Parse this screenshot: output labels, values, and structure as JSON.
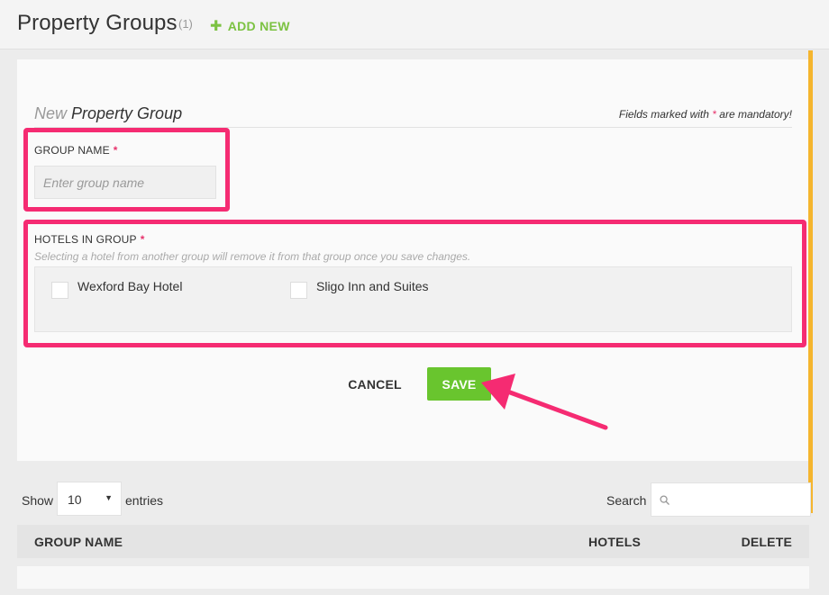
{
  "header": {
    "title": "Property Groups",
    "count": "(1)",
    "add_new_label": "ADD NEW",
    "add_new_icon": "plus-icon"
  },
  "form": {
    "heading_prefix": "New",
    "heading_main": "Property Group",
    "mandatory_note_before": "Fields marked with",
    "mandatory_note_star": "*",
    "mandatory_note_after": "are mandatory!",
    "group_name_label": "GROUP NAME",
    "group_name_required": "*",
    "group_name_value": "",
    "group_name_placeholder": "Enter group name",
    "hotels_label": "HOTELS IN GROUP",
    "hotels_required": "*",
    "hotels_help": "Selecting a hotel from another group will remove it from that group once you save changes.",
    "hotels": [
      {
        "label": "Wexford Bay Hotel",
        "checked": false
      },
      {
        "label": "Sligo Inn and Suites",
        "checked": false
      }
    ],
    "cancel_label": "CANCEL",
    "save_label": "SAVE"
  },
  "table_controls": {
    "show_label": "Show",
    "entries_value": "10",
    "entries_label": "entries",
    "search_label": "Search",
    "search_value": ""
  },
  "table": {
    "columns": [
      "GROUP NAME",
      "HOTELS",
      "DELETE"
    ]
  },
  "colors": {
    "accent_green": "#69c52e",
    "add_new_green": "#7cc242",
    "highlight_pink": "#f52b72",
    "required_star": "#e7336c",
    "side_bar_orange": "#f5b52e"
  }
}
